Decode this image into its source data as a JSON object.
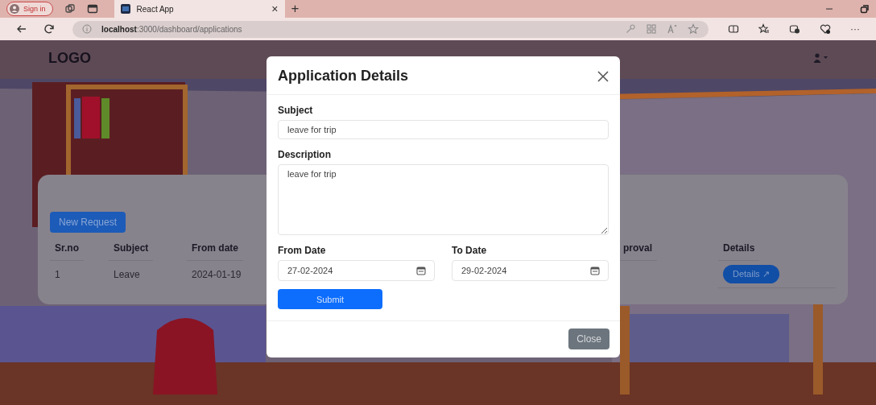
{
  "browser": {
    "profile_button": "Sign in",
    "tab": {
      "title": "React App",
      "close": "×"
    },
    "new_tab": "+",
    "address": {
      "host": "localhost",
      "path": ":3000/dashboard/applications"
    },
    "more": "···"
  },
  "navbar": {
    "logo": "LOGO"
  },
  "applications": {
    "new_request": "New Request",
    "columns": [
      "Sr.no",
      "Subject",
      "From date",
      "proval",
      "Details"
    ],
    "rows": [
      {
        "sr_no": "1",
        "subject": "Leave",
        "from_date": "2024-01-19",
        "details_button": "Details ↗"
      }
    ]
  },
  "modal": {
    "title": "Application Details",
    "subject": {
      "label": "Subject",
      "value": "leave for trip"
    },
    "description": {
      "label": "Description",
      "value": "leave for trip"
    },
    "from_date": {
      "label": "From Date",
      "value": "27-02-2024"
    },
    "to_date": {
      "label": "To Date",
      "value": "29-02-2024"
    },
    "submit": "Submit",
    "close": "Close"
  }
}
